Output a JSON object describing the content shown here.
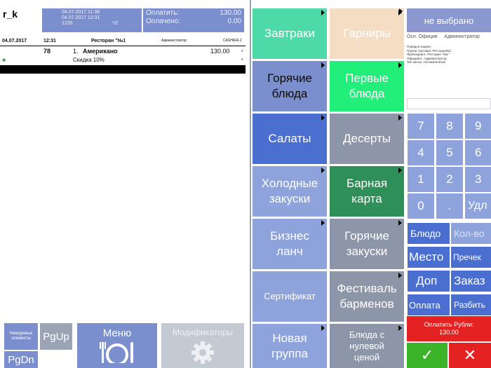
{
  "header": {
    "user": "r_k",
    "date_open": "04.07.2017 11:38",
    "date_now": "04.07.2017 12:31",
    "table_code": "1235",
    "guests": "*/2",
    "pay_label": "Оплатить:",
    "pay_value": "130.00",
    "paid_label": "Оплачено:",
    "paid_value": "0.00"
  },
  "order": {
    "date": "04.07.2017",
    "time": "12:31",
    "restaurant": "Ресторан \"№1",
    "role": "Администратор",
    "station": "CASHIER-2",
    "item": {
      "table": "78",
      "num": "1.",
      "name": "Американо",
      "price": "130.00"
    },
    "discount": "Скидка 10%"
  },
  "bottom_left": {
    "extra": "Невидимые элементы",
    "pgup": "PgUp",
    "pgdn": "PgDn",
    "menu": "Меню",
    "mods": "Модификаторы"
  },
  "categories": {
    "breakfast": "Завтраки",
    "sides": "Гарниры",
    "hot_dishes": "Горячие\nблюда",
    "first_courses": "Первые\nблюда",
    "salads": "Салаты",
    "desserts": "Десерты",
    "cold_snacks": "Холодные\nзакуски",
    "bar_menu": "Барная\nкарта",
    "business_lunch": "Бизнес\nланч",
    "hot_snacks": "Горячие\nзакуски",
    "certificate": "Сертификат",
    "festival": "Фестиваль\nбарменов",
    "new_group": "Новая\nгруппа",
    "zero_price": "Блюда с\nнулевой\nценой"
  },
  "info": {
    "title": "не выбрано",
    "tabs": [
      "Осн. Официв",
      "Администратор"
    ],
    "lines": [
      "Порядок подачи:",
      "Группа торговая: Ресторан№1",
      "Прейскурант: Ресторан \"№1\"",
      "Официант: Администратор",
      "Тип кассы: Автоматически"
    ]
  },
  "keypad": {
    "keys": [
      "7",
      "8",
      "9",
      "4",
      "5",
      "6",
      "1",
      "2",
      "3",
      "0",
      ".",
      "Удл"
    ]
  },
  "actions": {
    "dish": "Блюдо",
    "qty": "Кол-во",
    "place": "Место",
    "preprint": "Пречек",
    "extra": "Доп",
    "order": "Заказ",
    "payment": "Оплата",
    "split": "Разбить"
  },
  "pay": {
    "label": "Оплатить Рубли:",
    "value": "130.00"
  },
  "ok_glyph": "✓",
  "cancel_glyph": "✕",
  "colors": {
    "accent_blue": "#4a6fd0",
    "panel_blue": "#7b8fcf",
    "green": "#22ee7a",
    "teal": "#4ed9a8",
    "red": "#e52222",
    "ok_green": "#3bb42a"
  }
}
